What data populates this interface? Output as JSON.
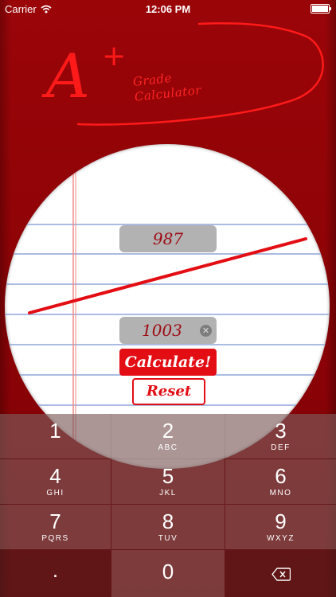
{
  "status_bar": {
    "carrier": "Carrier",
    "time": "12:06 PM"
  },
  "logo": {
    "mark": "A",
    "plus": "+",
    "line1": "Grade",
    "line2": "Calculator"
  },
  "form": {
    "earned_value": "987",
    "possible_value": "1003",
    "calculate_label": "Calculate!",
    "reset_label": "Reset"
  },
  "keypad": {
    "keys": [
      {
        "digit": "1",
        "letters": ""
      },
      {
        "digit": "2",
        "letters": "ABC"
      },
      {
        "digit": "3",
        "letters": "DEF"
      },
      {
        "digit": "4",
        "letters": "GHI"
      },
      {
        "digit": "5",
        "letters": "JKL"
      },
      {
        "digit": "6",
        "letters": "MNO"
      },
      {
        "digit": "7",
        "letters": "PQRS"
      },
      {
        "digit": "8",
        "letters": "TUV"
      },
      {
        "digit": "9",
        "letters": "WXYZ"
      }
    ],
    "dot": ".",
    "zero": "0"
  },
  "colors": {
    "background": "#8e0306",
    "accent_red": "#e30d14",
    "ink_red": "#ff2424",
    "field_gray": "#b2b2b2",
    "rule_blue": "#8fa6d8",
    "margin_red": "#f08a8a"
  },
  "icons": {
    "wifi": "wifi-icon",
    "battery": "battery-icon",
    "clear": "clear-icon",
    "backspace": "backspace-icon"
  }
}
